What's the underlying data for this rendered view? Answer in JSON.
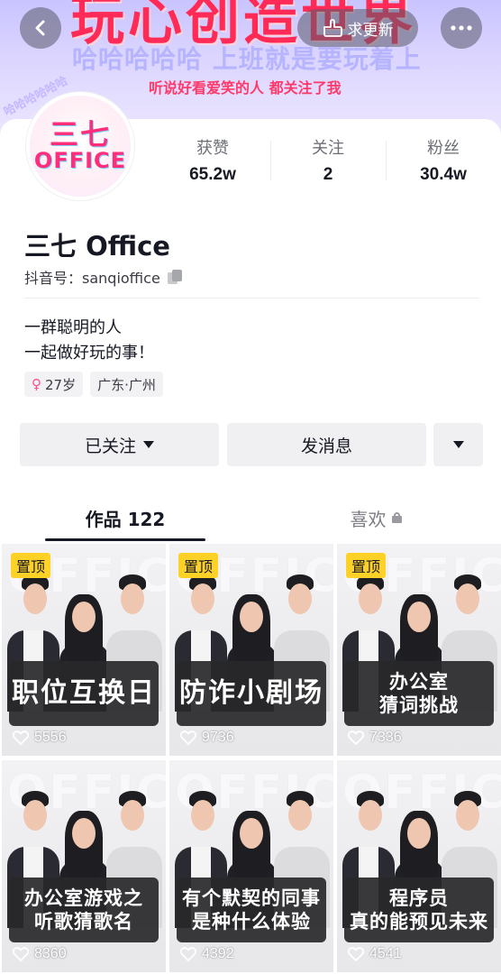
{
  "banner": {
    "title": "玩心创造世界",
    "slogan": "哈哈哈哈哈 上班就是要玩着上",
    "subtitle": "听说好看爱笑的人 都关注了我",
    "arc_text": "哈哈哈哈哈哈"
  },
  "topbar": {
    "update_label": "求更新"
  },
  "avatar": {
    "line1": "三七",
    "line2": "OFFICE"
  },
  "stats": [
    {
      "label": "获赞",
      "value": "65.2w"
    },
    {
      "label": "关注",
      "value": "2"
    },
    {
      "label": "粉丝",
      "value": "30.4w"
    }
  ],
  "profile": {
    "name": "三七 Office",
    "handle": "抖音号：sanqioffice",
    "bio_line1": "一群聪明的人",
    "bio_line2": "一起做好玩的事！",
    "tag_age": "27岁",
    "tag_location": "广东·广州"
  },
  "actions": {
    "follow_label": "已关注",
    "message_label": "发消息"
  },
  "tabs": {
    "works_label": "作品 122",
    "likes_label": "喜欢"
  },
  "videos": [
    {
      "pinned": true,
      "pin_label": "置顶",
      "caption1": "职位互换日",
      "caption2": "",
      "likes": "5556"
    },
    {
      "pinned": true,
      "pin_label": "置顶",
      "caption1": "防诈小剧场",
      "caption2": "",
      "likes": "9736"
    },
    {
      "pinned": true,
      "pin_label": "置顶",
      "caption1": "办公室",
      "caption2": "猜词挑战",
      "likes": "7336"
    },
    {
      "pinned": false,
      "pin_label": "",
      "caption1": "办公室游戏之",
      "caption2": "听歌猜歌名",
      "likes": "8360"
    },
    {
      "pinned": false,
      "pin_label": "",
      "caption1": "有个默契的同事",
      "caption2": "是种什么体验",
      "likes": "4392"
    },
    {
      "pinned": false,
      "pin_label": "",
      "caption1": "程序员",
      "caption2": "真的能预见未来",
      "likes": "4541"
    }
  ],
  "thumb_watermark": "OFFICE",
  "colors": {
    "accent_pink": "#ff2a55",
    "pin_yellow": "#fdd126",
    "button_gray": "#f0f0f2",
    "text_dark": "#161823"
  }
}
